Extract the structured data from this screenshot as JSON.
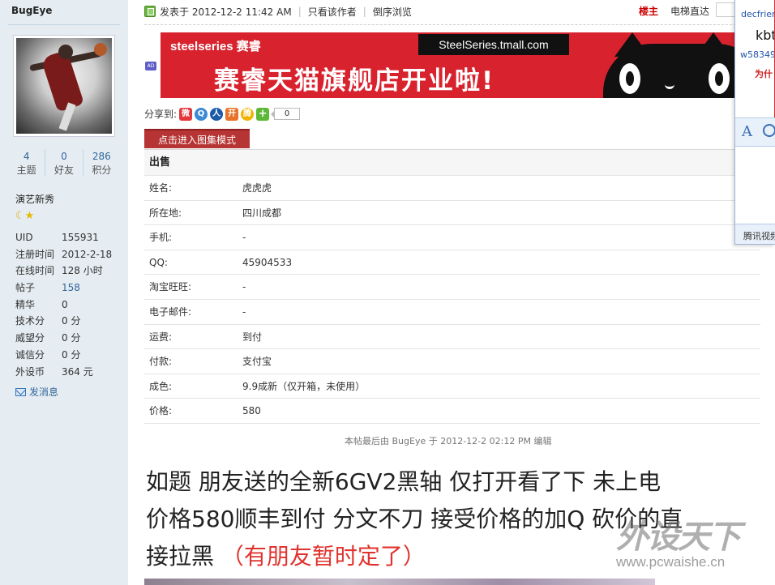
{
  "author": {
    "username": "BugEye",
    "stats": [
      {
        "value": "4",
        "label": "主题"
      },
      {
        "value": "0",
        "label": "好友"
      },
      {
        "value": "286",
        "label": "积分"
      }
    ],
    "group": "演艺新秀",
    "info": [
      {
        "key": "UID",
        "value": "155931"
      },
      {
        "key": "注册时间",
        "value": "2012-2-18"
      },
      {
        "key": "在线时间",
        "value": "128 小时"
      },
      {
        "key": "帖子",
        "value": "158"
      },
      {
        "key": "精华",
        "value": "0"
      },
      {
        "key": "技术分",
        "value": "0 分"
      },
      {
        "key": "威望分",
        "value": "0 分"
      },
      {
        "key": "诚信分",
        "value": "0 分"
      },
      {
        "key": "外设币",
        "value": "364 元"
      }
    ],
    "send_message": "发消息"
  },
  "postbar": {
    "posted": "发表于 2012-12-2 11:42 AM",
    "only_author": "只看该作者",
    "reverse": "倒序浏览",
    "floor": "楼主",
    "jump": "电梯直达"
  },
  "ad": {
    "tag": "AD",
    "brand": "steelseries 赛睿",
    "url_text": "SteelSeries.tmall.com",
    "headline": "赛睿天猫旗舰店开业啦!"
  },
  "share": {
    "label": "分享到:",
    "count": "0"
  },
  "album_tab": "点击进入图集模式",
  "sale": {
    "title": "出售",
    "rows": [
      {
        "key": "姓名:",
        "value": "虎虎虎"
      },
      {
        "key": "所在地:",
        "value": "四川成都"
      },
      {
        "key": "手机:",
        "value": "-"
      },
      {
        "key": "QQ:",
        "value": "45904533"
      },
      {
        "key": "淘宝旺旺:",
        "value": "-"
      },
      {
        "key": "电子邮件:",
        "value": "-"
      },
      {
        "key": "运费:",
        "value": "到付"
      },
      {
        "key": "付款:",
        "value": "支付宝"
      },
      {
        "key": "成色:",
        "value": "9.9成新（仅开箱，未使用）"
      },
      {
        "key": "价格:",
        "value": "580"
      }
    ]
  },
  "edited_note": "本帖最后由 BugEye 于 2012-12-2 02:12 PM 编辑",
  "body": {
    "line1": "如题 朋友送的全新6GV2黑轴 仅打开看了下 未上电",
    "line2": "价格580顺丰到付 分文不刀 接受价格的加Q 砍价的直",
    "line3_prefix": "接拉黑 ",
    "line3_red": "（有朋友暂时定了）"
  },
  "watermark": {
    "title": "外设天下",
    "url": "www.pcwaishe.cn"
  },
  "float_panel": {
    "line1": "decfrien",
    "line2": "kbt",
    "line3": "w58349",
    "line4": "为什",
    "footer": "腾讯视频"
  },
  "colors": {
    "sidebar_bg": "#e5edf2",
    "link": "#336699",
    "floor_red": "#cc0000",
    "banner_red": "#d8232f",
    "album_tab": "#b73434",
    "highlight_red": "#e0332e"
  }
}
